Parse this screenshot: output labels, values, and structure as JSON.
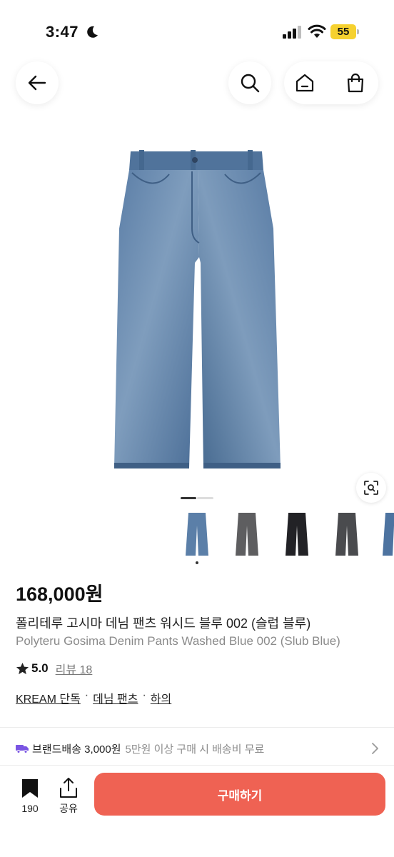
{
  "status": {
    "time": "3:47",
    "battery": "55",
    "icons": [
      "moon-icon",
      "signal-icon",
      "wifi-icon",
      "battery-icon"
    ]
  },
  "header": {
    "icons": [
      "arrow-left-icon",
      "search-icon",
      "home-icon",
      "shopping-bag-icon"
    ]
  },
  "gallery": {
    "page_index": 1,
    "page_count": 2,
    "thumbnails": [
      "washed-blue",
      "grey",
      "black",
      "charcoal",
      "blue"
    ],
    "selected_thumbnail": 0
  },
  "product": {
    "price": "168,000원",
    "title_ko": "폴리테루 고시마 데님 팬츠 워시드 블루 002 (슬럽 블루)",
    "title_en": "Polyteru Gosima Denim Pants Washed Blue 002 (Slub Blue)",
    "rating": "5.0",
    "review_link": "리뷰 18",
    "tags": [
      "KREAM 단독",
      "데님 팬츠",
      "하의"
    ],
    "tag_separator": "·"
  },
  "shipping": {
    "label": "브랜드배송 3,000원",
    "note": "5만원 이상 구매 시 배송비 무료"
  },
  "bottom_bar": {
    "bookmark_count": "190",
    "share_label": "공유",
    "buy_label": "구매하기"
  },
  "colors": {
    "accent": "#ef6253",
    "battery": "#f6d12f",
    "truck": "#7a55e3",
    "denim": "#4f74a0"
  }
}
